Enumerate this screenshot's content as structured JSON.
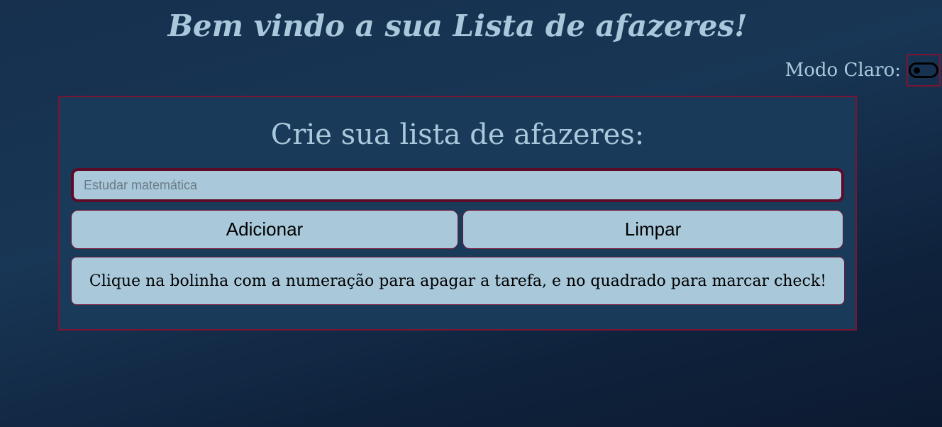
{
  "header": {
    "title": "Bem vindo a sua Lista de afazeres!"
  },
  "mode_toggle": {
    "label": "Modo Claro:",
    "state": "off"
  },
  "card": {
    "title": "Crie sua lista de afazeres:",
    "input": {
      "placeholder": "Estudar matemática",
      "value": ""
    },
    "add_button_label": "Adicionar",
    "clear_button_label": "Limpar",
    "info_text": "Clique na bolinha com a numeração para apagar a tarefa, e no quadrado para marcar check!"
  },
  "colors": {
    "background": "#16304e",
    "accent_text": "#a9c8db",
    "card_border": "#7a1534",
    "control_fill": "#a9c9db"
  }
}
